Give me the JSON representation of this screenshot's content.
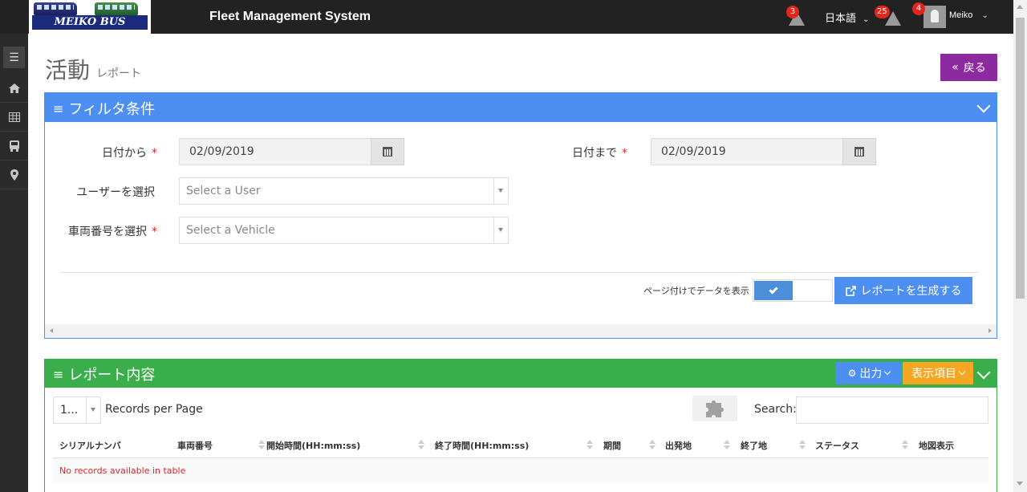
{
  "app": {
    "logo_text": "MEIKO BUS",
    "title": "Fleet Management System"
  },
  "navbar": {
    "alerts_count": "3",
    "language": "日本語",
    "notifications_count": "25",
    "user_badge": "4",
    "user_name": "Meiko"
  },
  "sidebar": {
    "items": [
      {
        "icon": "menu-icon"
      },
      {
        "icon": "home-icon"
      },
      {
        "icon": "table-icon"
      },
      {
        "icon": "bus-icon"
      },
      {
        "icon": "map-marker-icon"
      }
    ]
  },
  "page": {
    "title": "活動",
    "subtitle": "レポート",
    "back_label": "戻る"
  },
  "filter": {
    "header": "フィルタ条件",
    "date_from_label": "日付から",
    "date_from_value": "02/09/2019",
    "date_to_label": "日付まで",
    "date_to_value": "02/09/2019",
    "user_label": "ユーザーを選択",
    "user_placeholder": "Select a User",
    "vehicle_label": "車両番号を選択",
    "vehicle_placeholder": "Select a Vehicle",
    "required_mark": "*",
    "paginate_label": "ページ付けでデータを表示",
    "paginate_on": true,
    "generate_label": "レポートを生成する"
  },
  "report": {
    "header": "レポート内容",
    "export_label": "出力",
    "columns_label": "表示項目",
    "per_page_value": "1...",
    "per_page_label": "Records per Page",
    "search_label": "Search:",
    "search_value": "",
    "columns": [
      "シリアルナンバ",
      "車両番号",
      "開始時間(HH:mm:ss)",
      "終了時間(HH:mm:ss)",
      "期間",
      "出発地",
      "終了地",
      "ステータス",
      "地図表示"
    ],
    "empty_message": "No records available in table"
  },
  "colors": {
    "filter_header": "#4d8ff0",
    "report_header": "#3aae4a",
    "back_button": "#8e2aa0",
    "columns_button": "#f5a623",
    "badge": "#e2261d"
  }
}
